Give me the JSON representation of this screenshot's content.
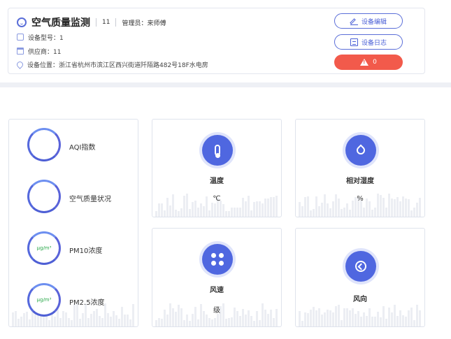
{
  "header": {
    "title": "空气质量监测",
    "count": "11",
    "admin": "管理员：来师傅",
    "model": "设备型号：1",
    "supplier": "供应商：11",
    "location": "设备位置：浙江省杭州市滨江区西兴街道阡陌路482号18F水电房",
    "edit_button": "设备编辑",
    "log_button": "设备日志",
    "alarm_count": "0"
  },
  "air_quality": {
    "items": [
      {
        "label": "AQI指数",
        "value": ""
      },
      {
        "label": "空气质量状况",
        "value": ""
      },
      {
        "label": "PM10浓度",
        "value": "μg/m³"
      },
      {
        "label": "PM2.5浓度",
        "value": "μg/m³"
      }
    ]
  },
  "metrics": [
    {
      "name": "温度",
      "unit": "℃",
      "icon": "thermometer-icon"
    },
    {
      "name": "相对湿度",
      "unit": "%",
      "icon": "water-drop-icon"
    },
    {
      "name": "风速",
      "unit": "级",
      "icon": "fan-icon"
    },
    {
      "name": "风向",
      "unit": "",
      "icon": "direction-icon"
    }
  ],
  "colors": {
    "accent": "#4f67e0",
    "alarm": "#f25a4b",
    "pm_text": "#2aa84a"
  }
}
